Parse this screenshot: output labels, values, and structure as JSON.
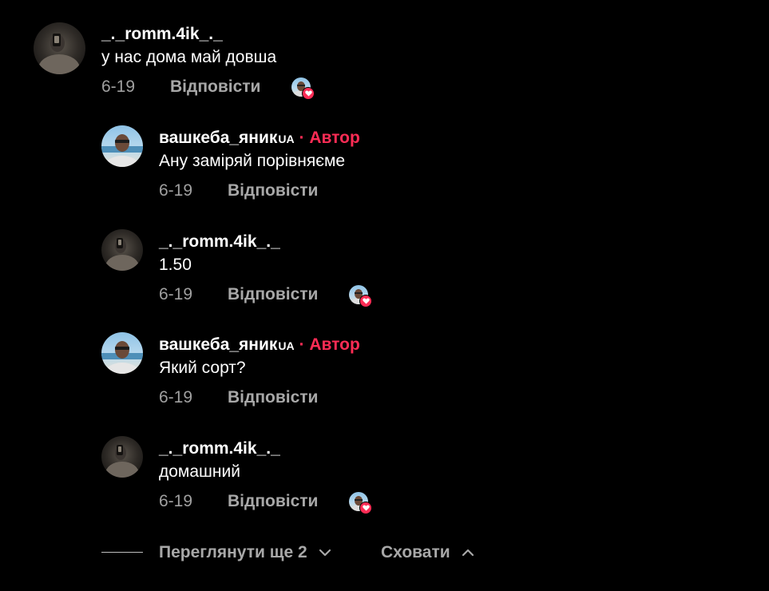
{
  "colors": {
    "background": "#000000",
    "text": "#ffffff",
    "muted": "#a8a8a8",
    "author_badge": "#fe2c55"
  },
  "comment_root": {
    "username": "_._romm.4ik_._",
    "text": "у нас дома май довша",
    "date": "6-19",
    "reply_label": "Відповісти",
    "liked_by_creator": true,
    "avatar_icon": "user-avatar-dark"
  },
  "replies": [
    {
      "username": "вашкеба_яник",
      "username_suffix": "UA",
      "author_label": "· Автор",
      "text": "Ану заміряй порівняєме",
      "date": "6-19",
      "reply_label": "Відповісти",
      "liked_by_creator": false,
      "avatar_icon": "creator-avatar-beach"
    },
    {
      "username": "_._romm.4ik_._",
      "text": "1.50",
      "date": "6-19",
      "reply_label": "Відповісти",
      "liked_by_creator": true,
      "avatar_icon": "user-avatar-dark"
    },
    {
      "username": "вашкеба_яник",
      "username_suffix": "UA",
      "author_label": "· Автор",
      "text": "Який сорт?",
      "date": "6-19",
      "reply_label": "Відповісти",
      "liked_by_creator": false,
      "avatar_icon": "creator-avatar-beach"
    },
    {
      "username": "_._romm.4ik_._",
      "text": "домашний",
      "date": "6-19",
      "reply_label": "Відповісти",
      "liked_by_creator": true,
      "avatar_icon": "user-avatar-dark"
    }
  ],
  "footer": {
    "view_more_label": "Переглянути ще 2",
    "hide_label": "Сховати",
    "view_more_icon": "chevron-down-icon",
    "hide_icon": "chevron-up-icon"
  }
}
